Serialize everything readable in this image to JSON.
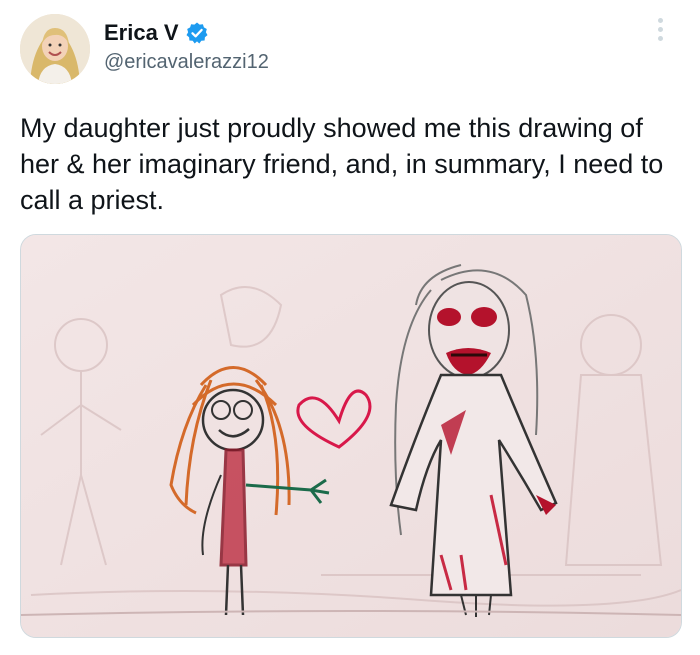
{
  "tweet": {
    "author_name": "Erica V",
    "handle": "@ericavalerazzi12",
    "text": "My daughter just proudly showed me this drawing of her & her imaginary friend, and, in summary, I need to call a priest."
  },
  "icons": {
    "verified": "verified-badge-icon",
    "more": "more-options-icon"
  },
  "colors": {
    "verified_blue": "#1d9bf0",
    "text_primary": "#0f1419",
    "text_secondary": "#536471"
  }
}
